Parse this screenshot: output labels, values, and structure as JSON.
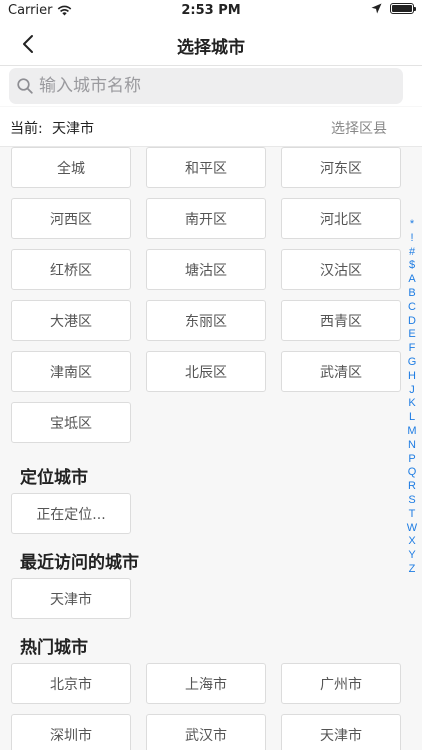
{
  "status_bar": {
    "carrier": "Carrier",
    "time": "2:53 PM",
    "battery_level": 1.0
  },
  "navbar": {
    "title": "选择城市"
  },
  "search": {
    "placeholder": "输入城市名称",
    "value": ""
  },
  "current": {
    "label": "当前:",
    "city": "天津市",
    "select_district": "选择区县"
  },
  "districts": [
    "全城",
    "和平区",
    "河东区",
    "河西区",
    "南开区",
    "河北区",
    "红桥区",
    "塘沽区",
    "汉沽区",
    "大港区",
    "东丽区",
    "西青区",
    "津南区",
    "北辰区",
    "武清区",
    "宝坻区"
  ],
  "locate": {
    "title": "定位城市",
    "status": "正在定位..."
  },
  "recent": {
    "title": "最近访问的城市",
    "cities": [
      "天津市"
    ]
  },
  "hot": {
    "title": "热门城市",
    "cities": [
      "北京市",
      "上海市",
      "广州市",
      "深圳市",
      "武汉市",
      "天津市"
    ]
  },
  "index_letters": [
    "*",
    "!",
    "#",
    "$",
    "A",
    "B",
    "C",
    "D",
    "E",
    "F",
    "G",
    "H",
    "J",
    "K",
    "L",
    "M",
    "N",
    "P",
    "Q",
    "R",
    "S",
    "T",
    "W",
    "X",
    "Y",
    "Z"
  ],
  "colors": {
    "accent": "#1f7de3",
    "background": "#f7f7f7"
  }
}
